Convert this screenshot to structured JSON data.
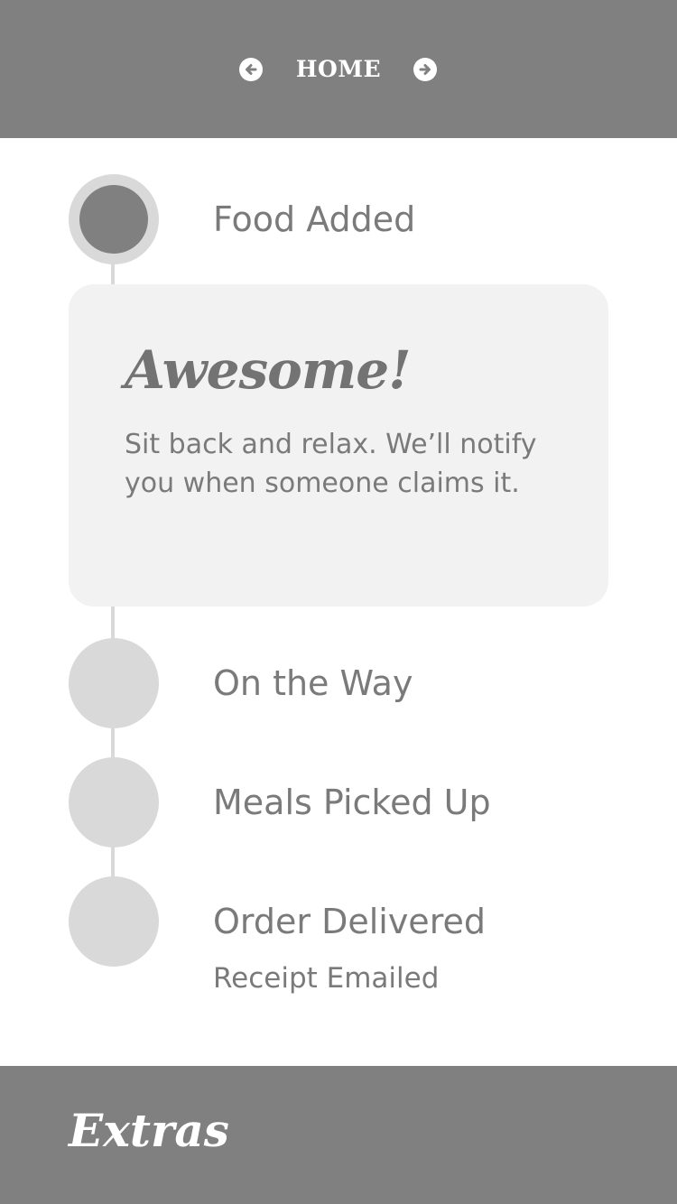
{
  "header": {
    "title": "HOME",
    "prev_icon": "arrow-left-circle-icon",
    "next_icon": "arrow-right-circle-icon"
  },
  "timeline": {
    "steps": [
      {
        "label": "Food Added",
        "status": "active"
      },
      {
        "label": "On the Way",
        "status": "pending"
      },
      {
        "label": "Meals Picked Up",
        "status": "pending"
      },
      {
        "label": "Order Delivered",
        "status": "pending",
        "sub": "Receipt Emailed"
      }
    ]
  },
  "card": {
    "title": "Awesome!",
    "text": "Sit back and relax. We’ll notify you when someone claims it."
  },
  "footer": {
    "title": "Extras"
  },
  "colors": {
    "header_bg": "#808080",
    "dot_active": "#808080",
    "dot_inactive": "#d9d9d9",
    "card_bg": "#f2f2f2",
    "text": "#7a7a7a"
  }
}
